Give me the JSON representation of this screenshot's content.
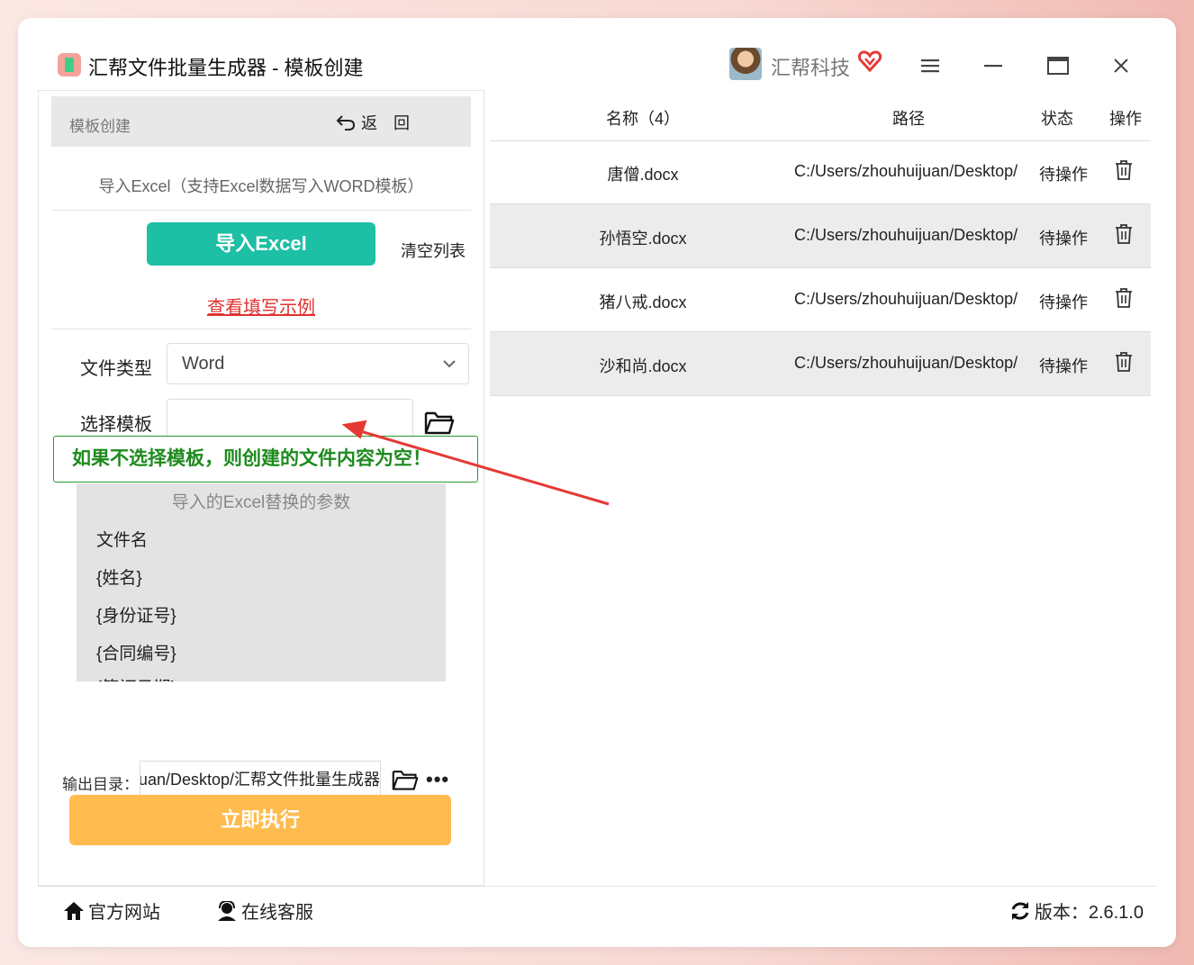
{
  "window": {
    "title": "汇帮文件批量生成器 - 模板创建",
    "brand": "汇帮科技"
  },
  "left_panel": {
    "header_title": "模板创建",
    "back_label": "返　回",
    "import_note": "导入Excel（支持Excel数据写入WORD模板）",
    "import_button": "导入Excel",
    "clear_button": "清空列表",
    "example_link": "查看填写示例",
    "file_type_label": "文件类型",
    "file_type_value": "Word",
    "template_label": "选择模板",
    "template_value": "",
    "callout": "如果不选择模板，则创建的文件内容为空！",
    "params_title": "导入的Excel替换的参数",
    "params": [
      "文件名",
      "{姓名}",
      "{身份证号}",
      "{合同编号}",
      "{签订日期}"
    ],
    "output_label": "输出目录：",
    "output_value": "C:/Users/zhouhuijuan/Desktop/汇帮文件批量生成器",
    "run_button": "立即执行"
  },
  "table": {
    "headers": {
      "name": "名称（4）",
      "path": "路径",
      "status": "状态",
      "action": "操作"
    },
    "rows": [
      {
        "name": "唐僧.docx",
        "path": "C:/Users/zhouhuijuan/Desktop/",
        "status": "待操作"
      },
      {
        "name": "孙悟空.docx",
        "path": "C:/Users/zhouhuijuan/Desktop/",
        "status": "待操作"
      },
      {
        "name": "猪八戒.docx",
        "path": "C:/Users/zhouhuijuan/Desktop/",
        "status": "待操作"
      },
      {
        "name": "沙和尚.docx",
        "path": "C:/Users/zhouhuijuan/Desktop/",
        "status": "待操作"
      }
    ]
  },
  "footer": {
    "website": "官方网站",
    "support": "在线客服",
    "version": "版本：2.6.1.0"
  },
  "colors": {
    "import_green": "#1dbfa5",
    "run_orange": "#ffbb4d",
    "link_red": "#e0322f",
    "callout_green": "#1e8a1e",
    "arrow_red": "#e53935"
  }
}
